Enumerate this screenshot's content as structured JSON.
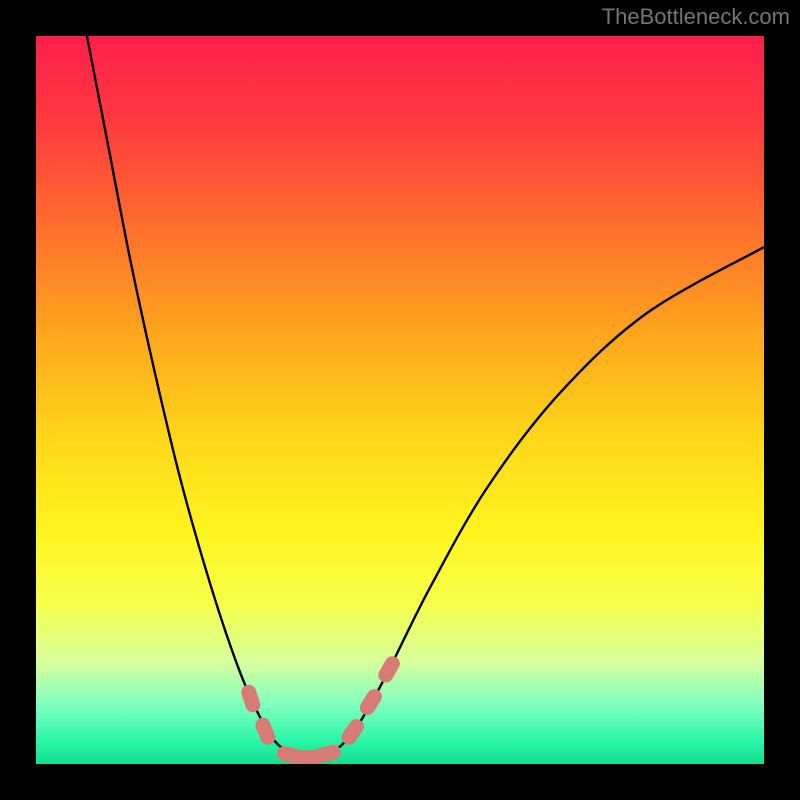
{
  "watermark": "TheBottleneck.com",
  "chart_data": {
    "type": "line",
    "title": "",
    "xlabel": "",
    "ylabel": "",
    "xlim": [
      0,
      100
    ],
    "ylim": [
      0,
      100
    ],
    "background_gradient": {
      "stops": [
        {
          "pos": 0.0,
          "color": "#ff1f4b"
        },
        {
          "pos": 0.12,
          "color": "#ff3a3f"
        },
        {
          "pos": 0.25,
          "color": "#ff6a2f"
        },
        {
          "pos": 0.4,
          "color": "#ffa21e"
        },
        {
          "pos": 0.55,
          "color": "#ffd619"
        },
        {
          "pos": 0.68,
          "color": "#fff41f"
        },
        {
          "pos": 0.78,
          "color": "#f6ff4a"
        },
        {
          "pos": 0.86,
          "color": "#d6ff9c"
        },
        {
          "pos": 0.92,
          "color": "#7effc0"
        },
        {
          "pos": 0.97,
          "color": "#29f5a6"
        },
        {
          "pos": 1.0,
          "color": "#11df8e"
        }
      ]
    },
    "series": [
      {
        "name": "bottleneck-curve",
        "color": "#000000",
        "points": [
          {
            "x": 7.0,
            "y": 100.0
          },
          {
            "x": 10.0,
            "y": 84.5
          },
          {
            "x": 13.0,
            "y": 69.0
          },
          {
            "x": 16.5,
            "y": 53.0
          },
          {
            "x": 20.0,
            "y": 38.5
          },
          {
            "x": 24.0,
            "y": 24.5
          },
          {
            "x": 27.5,
            "y": 14.0
          },
          {
            "x": 30.0,
            "y": 8.0
          },
          {
            "x": 32.5,
            "y": 3.5
          },
          {
            "x": 35.0,
            "y": 1.5
          },
          {
            "x": 38.0,
            "y": 0.8
          },
          {
            "x": 41.0,
            "y": 1.8
          },
          {
            "x": 44.0,
            "y": 5.0
          },
          {
            "x": 48.0,
            "y": 12.0
          },
          {
            "x": 54.0,
            "y": 24.0
          },
          {
            "x": 62.0,
            "y": 38.0
          },
          {
            "x": 72.0,
            "y": 51.0
          },
          {
            "x": 84.0,
            "y": 62.0
          },
          {
            "x": 100.0,
            "y": 71.0
          }
        ]
      }
    ],
    "markers": [
      {
        "name": "marker-left-upper",
        "color": "#d77b77",
        "x": 29.5,
        "y": 9.0,
        "rot": 72
      },
      {
        "name": "marker-left-lower",
        "color": "#d77b77",
        "x": 31.5,
        "y": 4.5,
        "rot": 68
      },
      {
        "name": "marker-valley-1",
        "color": "#d77b77",
        "x": 35.0,
        "y": 1.2,
        "rot": 14
      },
      {
        "name": "marker-valley-2",
        "color": "#d77b77",
        "x": 37.5,
        "y": 0.9,
        "rot": 0
      },
      {
        "name": "marker-valley-3",
        "color": "#d77b77",
        "x": 40.0,
        "y": 1.4,
        "rot": -14
      },
      {
        "name": "marker-right-lower",
        "color": "#d77b77",
        "x": 43.5,
        "y": 4.4,
        "rot": -55
      },
      {
        "name": "marker-right-mid",
        "color": "#d77b77",
        "x": 46.0,
        "y": 8.5,
        "rot": -58
      },
      {
        "name": "marker-right-upper",
        "color": "#d77b77",
        "x": 48.5,
        "y": 13.0,
        "rot": -60
      }
    ]
  }
}
